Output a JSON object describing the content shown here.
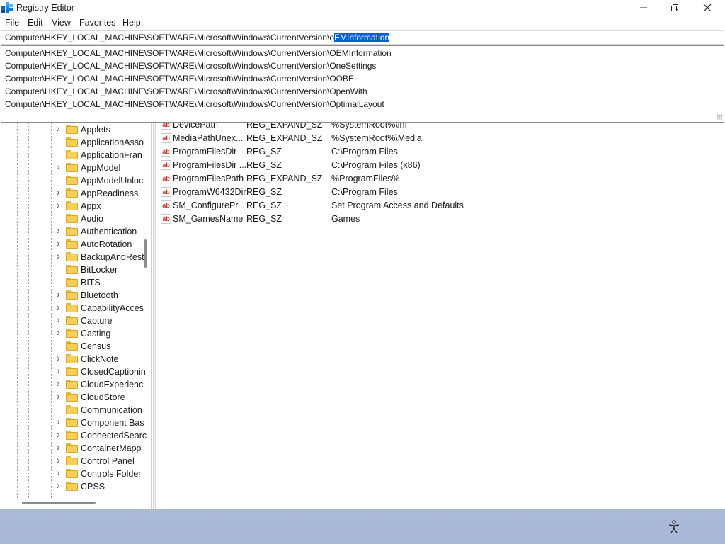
{
  "window": {
    "title": "Registry Editor"
  },
  "menu": [
    "File",
    "Edit",
    "View",
    "Favorites",
    "Help"
  ],
  "address": {
    "prefix": "Computer\\HKEY_LOCAL_MACHINE\\SOFTWARE\\Microsoft\\Windows\\CurrentVersion\\o",
    "selected": "EMInformation"
  },
  "suggestions": [
    "Computer\\HKEY_LOCAL_MACHINE\\SOFTWARE\\Microsoft\\Windows\\CurrentVersion\\OEMInformation",
    "Computer\\HKEY_LOCAL_MACHINE\\SOFTWARE\\Microsoft\\Windows\\CurrentVersion\\OneSettings",
    "Computer\\HKEY_LOCAL_MACHINE\\SOFTWARE\\Microsoft\\Windows\\CurrentVersion\\OOBE",
    "Computer\\HKEY_LOCAL_MACHINE\\SOFTWARE\\Microsoft\\Windows\\CurrentVersion\\OpenWith",
    "Computer\\HKEY_LOCAL_MACHINE\\SOFTWARE\\Microsoft\\Windows\\CurrentVersion\\OptimalLayout"
  ],
  "tree": [
    {
      "label": "Applets",
      "expandable": true
    },
    {
      "label": "ApplicationAsso",
      "expandable": false
    },
    {
      "label": "ApplicationFran",
      "expandable": false
    },
    {
      "label": "AppModel",
      "expandable": true
    },
    {
      "label": "AppModelUnloc",
      "expandable": false
    },
    {
      "label": "AppReadiness",
      "expandable": true
    },
    {
      "label": "Appx",
      "expandable": true
    },
    {
      "label": "Audio",
      "expandable": false
    },
    {
      "label": "Authentication",
      "expandable": true
    },
    {
      "label": "AutoRotation",
      "expandable": true
    },
    {
      "label": "BackupAndRest",
      "expandable": true
    },
    {
      "label": "BitLocker",
      "expandable": false
    },
    {
      "label": "BITS",
      "expandable": false
    },
    {
      "label": "Bluetooth",
      "expandable": true
    },
    {
      "label": "CapabilityAcces",
      "expandable": true
    },
    {
      "label": "Capture",
      "expandable": true
    },
    {
      "label": "Casting",
      "expandable": true
    },
    {
      "label": "Census",
      "expandable": false
    },
    {
      "label": "ClickNote",
      "expandable": true
    },
    {
      "label": "ClosedCaptionin",
      "expandable": true
    },
    {
      "label": "CloudExperienc",
      "expandable": true
    },
    {
      "label": "CloudStore",
      "expandable": true
    },
    {
      "label": "Communication",
      "expandable": false
    },
    {
      "label": "Component Bas",
      "expandable": true
    },
    {
      "label": "ConnectedSearc",
      "expandable": true
    },
    {
      "label": "ContainerMapp",
      "expandable": true
    },
    {
      "label": "Control Panel",
      "expandable": true
    },
    {
      "label": "Controls Folder",
      "expandable": true
    },
    {
      "label": "CPSS",
      "expandable": true
    }
  ],
  "values": [
    {
      "name": "DevicePath",
      "type": "REG_EXPAND_SZ",
      "data": "%SystemRoot%\\inf"
    },
    {
      "name": "MediaPathUnex...",
      "type": "REG_EXPAND_SZ",
      "data": "%SystemRoot%\\Media"
    },
    {
      "name": "ProgramFilesDir",
      "type": "REG_SZ",
      "data": "C:\\Program Files"
    },
    {
      "name": "ProgramFilesDir ...",
      "type": "REG_SZ",
      "data": "C:\\Program Files (x86)"
    },
    {
      "name": "ProgramFilesPath",
      "type": "REG_EXPAND_SZ",
      "data": "%ProgramFiles%"
    },
    {
      "name": "ProgramW6432Dir",
      "type": "REG_SZ",
      "data": "C:\\Program Files"
    },
    {
      "name": "SM_ConfigurePr...",
      "type": "REG_SZ",
      "data": "Set Program Access and Defaults"
    },
    {
      "name": "SM_GamesName",
      "type": "REG_SZ",
      "data": "Games"
    }
  ],
  "value_icon_text": "ab",
  "colors": {
    "selection": "#0a5fd3",
    "folder": "#f7cf57",
    "accent_icon": "#1565c0"
  }
}
